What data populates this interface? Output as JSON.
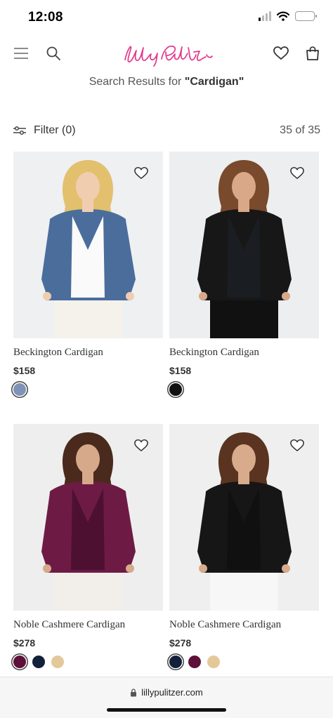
{
  "status_bar": {
    "time": "12:08",
    "battery_level": 0.55,
    "signal_bars_active": 1,
    "battery_color": "#f5c518"
  },
  "header": {
    "logo_text": "Lilly Pulitzer",
    "logo_color": "#e2388c",
    "icons": [
      "menu-icon",
      "search-icon",
      "heart-icon",
      "shopping-bag-icon"
    ]
  },
  "search": {
    "prefix": "Search Results for",
    "query": "\"Cardigan\""
  },
  "toolbar": {
    "filter_label": "Filter (0)",
    "count": "35 of 35"
  },
  "products": [
    {
      "name": "Beckington Cardigan",
      "price": "$158",
      "swatches": [
        "#7f93b6"
      ],
      "selected": 0,
      "illustration": {
        "bg": "#eef0f2",
        "garment": "#4a6d9c",
        "top": "#fafafa",
        "bottom": "#f5f2ec",
        "hair": "#e2c06e",
        "skin": "#f1cdb0"
      }
    },
    {
      "name": "Beckington Cardigan",
      "price": "$158",
      "swatches": [
        "#111111"
      ],
      "selected": 0,
      "illustration": {
        "bg": "#eceeef",
        "garment": "#171717",
        "top": "#1a1d22",
        "bottom": "#111111",
        "hair": "#7a4a2c",
        "skin": "#d9a889"
      }
    },
    {
      "name": "Noble Cashmere Cardigan",
      "price": "$278",
      "swatches": [
        "#5e1138",
        "#13203a",
        "#e3c99a"
      ],
      "selected": 0,
      "illustration": {
        "bg": "#eeeeee",
        "garment": "#6d1b45",
        "top": "#4e1030",
        "bottom": "#f2eee9",
        "hair": "#4a2a1c",
        "skin": "#d6a98a"
      }
    },
    {
      "name": "Noble Cashmere Cardigan",
      "price": "$278",
      "swatches": [
        "#13203a",
        "#5e1138",
        "#e3c99a"
      ],
      "selected": 0,
      "illustration": {
        "bg": "#efefef",
        "garment": "#161616",
        "top": "#101010",
        "bottom": "#f7f7f7",
        "hair": "#5a3420",
        "skin": "#d8ab8c"
      }
    }
  ],
  "browser": {
    "url": "lillypulitzer.com"
  }
}
